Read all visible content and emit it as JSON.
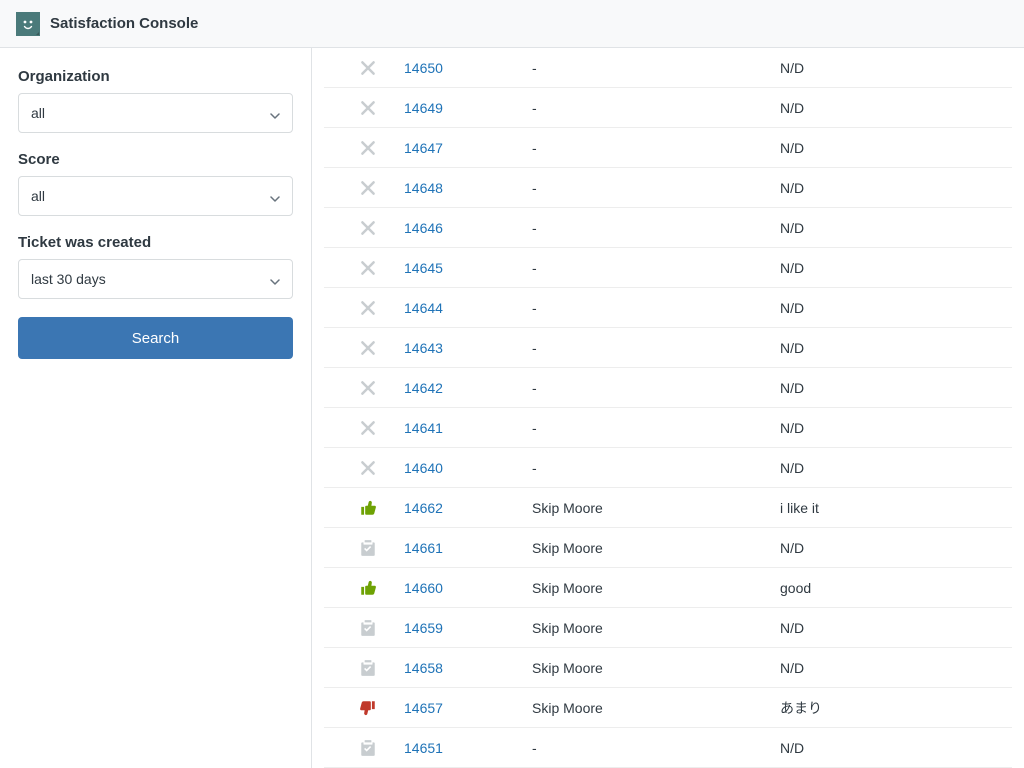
{
  "header": {
    "title": "Satisfaction Console"
  },
  "sidebar": {
    "org_label": "Organization",
    "org_value": "all",
    "score_label": "Score",
    "score_value": "all",
    "created_label": "Ticket was created",
    "created_value": "last 30 days",
    "search_label": "Search"
  },
  "rows": [
    {
      "icon": "unrated",
      "ticket": "14650",
      "requester": "-",
      "comment": "N/D"
    },
    {
      "icon": "unrated",
      "ticket": "14649",
      "requester": "-",
      "comment": "N/D"
    },
    {
      "icon": "unrated",
      "ticket": "14647",
      "requester": "-",
      "comment": "N/D"
    },
    {
      "icon": "unrated",
      "ticket": "14648",
      "requester": "-",
      "comment": "N/D"
    },
    {
      "icon": "unrated",
      "ticket": "14646",
      "requester": "-",
      "comment": "N/D"
    },
    {
      "icon": "unrated",
      "ticket": "14645",
      "requester": "-",
      "comment": "N/D"
    },
    {
      "icon": "unrated",
      "ticket": "14644",
      "requester": "-",
      "comment": "N/D"
    },
    {
      "icon": "unrated",
      "ticket": "14643",
      "requester": "-",
      "comment": "N/D"
    },
    {
      "icon": "unrated",
      "ticket": "14642",
      "requester": "-",
      "comment": "N/D"
    },
    {
      "icon": "unrated",
      "ticket": "14641",
      "requester": "-",
      "comment": "N/D"
    },
    {
      "icon": "unrated",
      "ticket": "14640",
      "requester": "-",
      "comment": "N/D"
    },
    {
      "icon": "good",
      "ticket": "14662",
      "requester": "Skip Moore",
      "comment": "i like it"
    },
    {
      "icon": "offered",
      "ticket": "14661",
      "requester": "Skip Moore",
      "comment": "N/D"
    },
    {
      "icon": "good",
      "ticket": "14660",
      "requester": "Skip Moore",
      "comment": "good"
    },
    {
      "icon": "offered",
      "ticket": "14659",
      "requester": "Skip Moore",
      "comment": "N/D"
    },
    {
      "icon": "offered",
      "ticket": "14658",
      "requester": "Skip Moore",
      "comment": "N/D"
    },
    {
      "icon": "bad",
      "ticket": "14657",
      "requester": "Skip Moore",
      "comment": "あまり"
    },
    {
      "icon": "offered",
      "ticket": "14651",
      "requester": "-",
      "comment": "N/D"
    }
  ]
}
